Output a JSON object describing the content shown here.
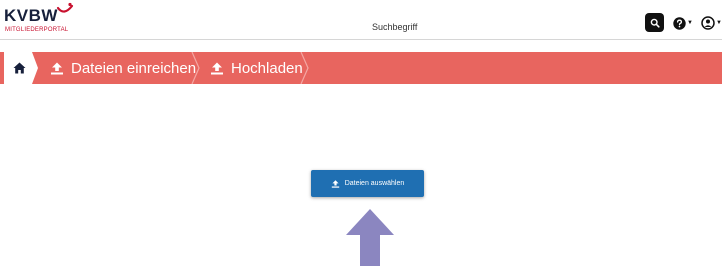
{
  "header": {
    "logo": {
      "main": "KVBW",
      "sub": "MITGLIEDERPORTAL"
    },
    "search": {
      "placeholder": "Suchbegriff",
      "value": ""
    },
    "icons": {
      "search": "search-icon",
      "help": "question-circle-icon",
      "user": "user-circle-icon",
      "caret": "caret-down-icon"
    }
  },
  "breadcrumb": {
    "home_icon": "home-icon",
    "items": [
      {
        "label": "Dateien einreichen",
        "icon": "upload-icon"
      },
      {
        "label": "Hochladen",
        "icon": "upload-icon"
      }
    ]
  },
  "main": {
    "upload_button_label": "Dateien auswählen",
    "upload_button_icon": "upload-icon",
    "pointer_arrow_icon": "arrow-up-icon"
  },
  "colors": {
    "brand_red": "#e8655f",
    "logo_navy": "#17203b",
    "logo_accent": "#c8102e",
    "primary_button": "#1f6fb2",
    "arrow": "#8b86c0"
  }
}
